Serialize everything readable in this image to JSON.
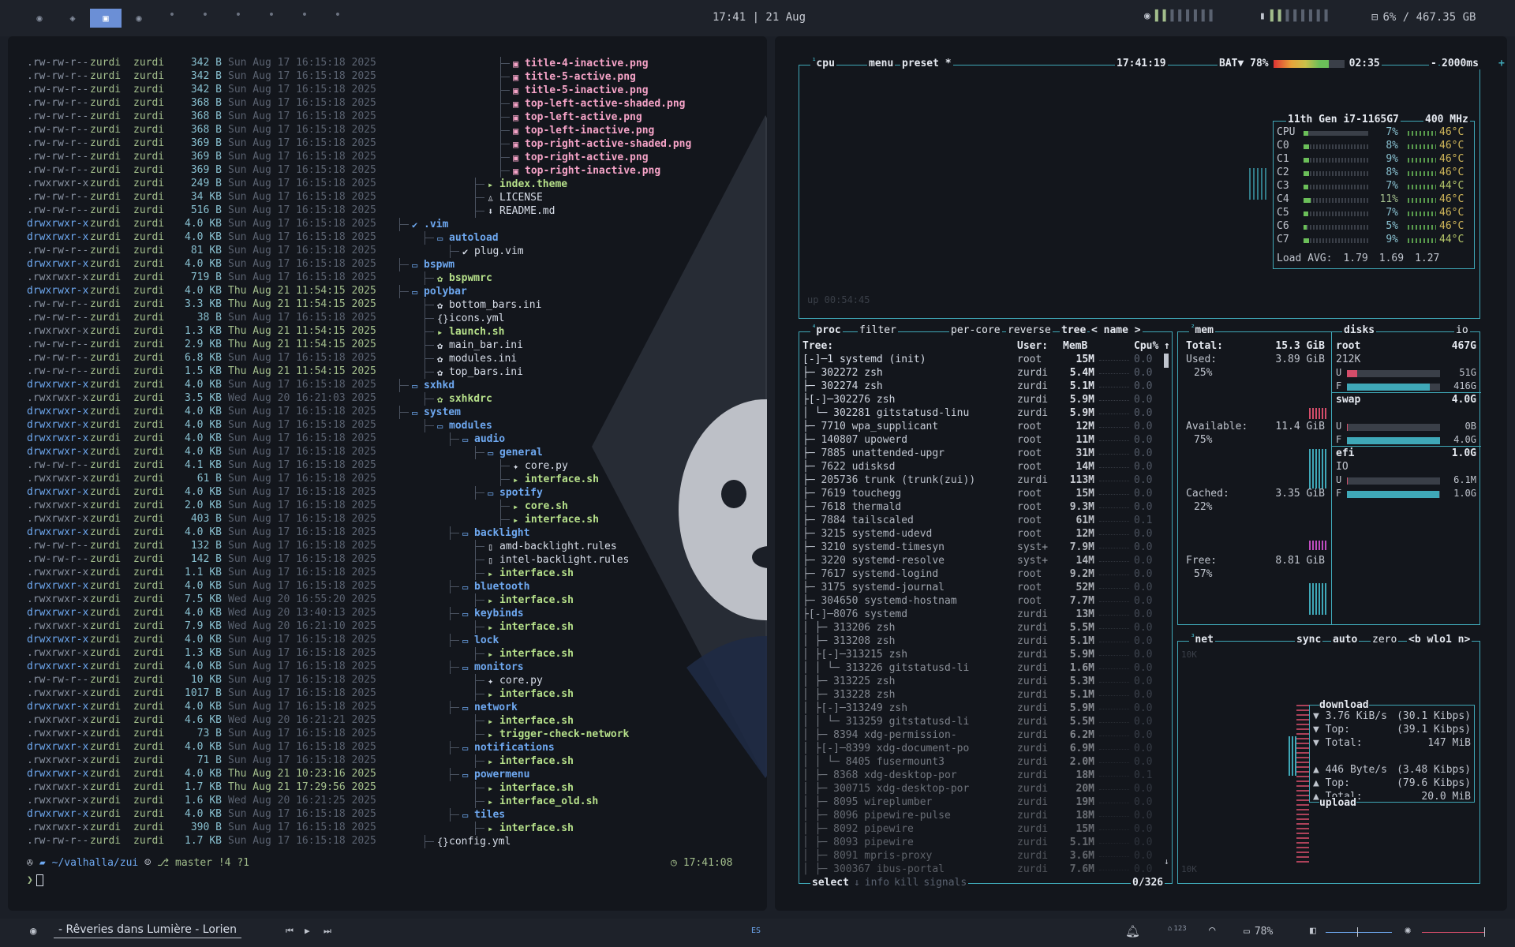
{
  "topbar": {
    "workspaces": [
      "◉",
      "◈",
      "▣",
      "◉"
    ],
    "clock": "17:41 | 21 Aug",
    "disk": "6% / 467.35 GB"
  },
  "bottombar": {
    "song": "- Rêveries dans Lumière - Lorien",
    "layout": "ES",
    "badge": "123",
    "battery": "78%"
  },
  "ls": [
    {
      "p": ".rw-rw-r--",
      "s": "342 B",
      "d": "Sun Aug 17 16:15:18 2025",
      "n": 0
    },
    {
      "p": ".rw-rw-r--",
      "s": "342 B",
      "d": "Sun Aug 17 16:15:18 2025",
      "n": 0
    },
    {
      "p": ".rw-rw-r--",
      "s": "342 B",
      "d": "Sun Aug 17 16:15:18 2025",
      "n": 0
    },
    {
      "p": ".rw-rw-r--",
      "s": "368 B",
      "d": "Sun Aug 17 16:15:18 2025",
      "n": 0
    },
    {
      "p": ".rw-rw-r--",
      "s": "368 B",
      "d": "Sun Aug 17 16:15:18 2025",
      "n": 0
    },
    {
      "p": ".rw-rw-r--",
      "s": "368 B",
      "d": "Sun Aug 17 16:15:18 2025",
      "n": 0
    },
    {
      "p": ".rw-rw-r--",
      "s": "369 B",
      "d": "Sun Aug 17 16:15:18 2025",
      "n": 0
    },
    {
      "p": ".rw-rw-r--",
      "s": "369 B",
      "d": "Sun Aug 17 16:15:18 2025",
      "n": 0
    },
    {
      "p": ".rw-rw-r--",
      "s": "369 B",
      "d": "Sun Aug 17 16:15:18 2025",
      "n": 0
    },
    {
      "p": ".rwxrwxr-x",
      "s": "249 B",
      "d": "Sun Aug 17 16:15:18 2025",
      "n": 0
    },
    {
      "p": ".rw-rw-r--",
      "s": "34 KB",
      "d": "Sun Aug 17 16:15:18 2025",
      "n": 0
    },
    {
      "p": ".rw-rw-r--",
      "s": "516 B",
      "d": "Sun Aug 17 16:15:18 2025",
      "n": 0
    },
    {
      "p": "drwxrwxr-x",
      "s": "4.0 KB",
      "d": "Sun Aug 17 16:15:18 2025",
      "n": 0
    },
    {
      "p": "drwxrwxr-x",
      "s": "4.0 KB",
      "d": "Sun Aug 17 16:15:18 2025",
      "n": 0
    },
    {
      "p": ".rw-rw-r--",
      "s": "81 KB",
      "d": "Sun Aug 17 16:15:18 2025",
      "n": 0
    },
    {
      "p": "drwxrwxr-x",
      "s": "4.0 KB",
      "d": "Sun Aug 17 16:15:18 2025",
      "n": 0
    },
    {
      "p": ".rwxrwxr-x",
      "s": "719 B",
      "d": "Sun Aug 17 16:15:18 2025",
      "n": 0
    },
    {
      "p": "drwxrwxr-x",
      "s": "4.0 KB",
      "d": "Thu Aug 21 11:54:15 2025",
      "n": 1
    },
    {
      "p": ".rw-rw-r--",
      "s": "3.3 KB",
      "d": "Thu Aug 21 11:54:15 2025",
      "n": 1
    },
    {
      "p": ".rw-rw-r--",
      "s": "38 B",
      "d": "Sun Aug 17 16:15:18 2025",
      "n": 0
    },
    {
      "p": ".rwxrwxr-x",
      "s": "1.3 KB",
      "d": "Thu Aug 21 11:54:15 2025",
      "n": 1
    },
    {
      "p": ".rw-rw-r--",
      "s": "2.9 KB",
      "d": "Thu Aug 21 11:54:15 2025",
      "n": 1
    },
    {
      "p": ".rw-rw-r--",
      "s": "6.8 KB",
      "d": "Sun Aug 17 16:15:18 2025",
      "n": 0
    },
    {
      "p": ".rw-rw-r--",
      "s": "1.5 KB",
      "d": "Thu Aug 21 11:54:15 2025",
      "n": 1
    },
    {
      "p": "drwxrwxr-x",
      "s": "4.0 KB",
      "d": "Sun Aug 17 16:15:18 2025",
      "n": 0
    },
    {
      "p": ".rwxrwxr-x",
      "s": "3.5 KB",
      "d": "Wed Aug 20 16:21:03 2025",
      "n": 0
    },
    {
      "p": "drwxrwxr-x",
      "s": "4.0 KB",
      "d": "Sun Aug 17 16:15:18 2025",
      "n": 0
    },
    {
      "p": "drwxrwxr-x",
      "s": "4.0 KB",
      "d": "Sun Aug 17 16:15:18 2025",
      "n": 0
    },
    {
      "p": "drwxrwxr-x",
      "s": "4.0 KB",
      "d": "Sun Aug 17 16:15:18 2025",
      "n": 0
    },
    {
      "p": "drwxrwxr-x",
      "s": "4.0 KB",
      "d": "Sun Aug 17 16:15:18 2025",
      "n": 0
    },
    {
      "p": ".rw-rw-r--",
      "s": "4.1 KB",
      "d": "Sun Aug 17 16:15:18 2025",
      "n": 0
    },
    {
      "p": ".rwxrwxr-x",
      "s": "61 B",
      "d": "Sun Aug 17 16:15:18 2025",
      "n": 0
    },
    {
      "p": "drwxrwxr-x",
      "s": "4.0 KB",
      "d": "Sun Aug 17 16:15:18 2025",
      "n": 0
    },
    {
      "p": ".rwxrwxr-x",
      "s": "2.0 KB",
      "d": "Sun Aug 17 16:15:18 2025",
      "n": 0
    },
    {
      "p": ".rwxrwxr-x",
      "s": "403 B",
      "d": "Sun Aug 17 16:15:18 2025",
      "n": 0
    },
    {
      "p": "drwxrwxr-x",
      "s": "4.0 KB",
      "d": "Sun Aug 17 16:15:18 2025",
      "n": 0
    },
    {
      "p": ".rw-rw-r--",
      "s": "132 B",
      "d": "Sun Aug 17 16:15:18 2025",
      "n": 0
    },
    {
      "p": ".rw-rw-r--",
      "s": "142 B",
      "d": "Sun Aug 17 16:15:18 2025",
      "n": 0
    },
    {
      "p": ".rwxrwxr-x",
      "s": "1.1 KB",
      "d": "Sun Aug 17 16:15:18 2025",
      "n": 0
    },
    {
      "p": "drwxrwxr-x",
      "s": "4.0 KB",
      "d": "Sun Aug 17 16:15:18 2025",
      "n": 0
    },
    {
      "p": ".rwxrwxr-x",
      "s": "7.5 KB",
      "d": "Wed Aug 20 16:55:20 2025",
      "n": 0
    },
    {
      "p": "drwxrwxr-x",
      "s": "4.0 KB",
      "d": "Wed Aug 20 13:40:13 2025",
      "n": 0
    },
    {
      "p": ".rwxrwxr-x",
      "s": "7.9 KB",
      "d": "Wed Aug 20 16:21:10 2025",
      "n": 0
    },
    {
      "p": "drwxrwxr-x",
      "s": "4.0 KB",
      "d": "Sun Aug 17 16:15:18 2025",
      "n": 0
    },
    {
      "p": ".rwxrwxr-x",
      "s": "1.3 KB",
      "d": "Sun Aug 17 16:15:18 2025",
      "n": 0
    },
    {
      "p": "drwxrwxr-x",
      "s": "4.0 KB",
      "d": "Sun Aug 17 16:15:18 2025",
      "n": 0
    },
    {
      "p": ".rw-rw-r--",
      "s": "10 KB",
      "d": "Sun Aug 17 16:15:18 2025",
      "n": 0
    },
    {
      "p": ".rwxrwxr-x",
      "s": "1017 B",
      "d": "Sun Aug 17 16:15:18 2025",
      "n": 0
    },
    {
      "p": "drwxrwxr-x",
      "s": "4.0 KB",
      "d": "Sun Aug 17 16:15:18 2025",
      "n": 0
    },
    {
      "p": ".rwxrwxr-x",
      "s": "4.6 KB",
      "d": "Wed Aug 20 16:21:21 2025",
      "n": 0
    },
    {
      "p": ".rwxrwxr-x",
      "s": "73 B",
      "d": "Sun Aug 17 16:15:18 2025",
      "n": 0
    },
    {
      "p": "drwxrwxr-x",
      "s": "4.0 KB",
      "d": "Sun Aug 17 16:15:18 2025",
      "n": 0
    },
    {
      "p": ".rwxrwxr-x",
      "s": "71 B",
      "d": "Sun Aug 17 16:15:18 2025",
      "n": 0
    },
    {
      "p": "drwxrwxr-x",
      "s": "4.0 KB",
      "d": "Thu Aug 21 10:23:16 2025",
      "n": 1
    },
    {
      "p": ".rwxrwxr-x",
      "s": "1.7 KB",
      "d": "Thu Aug 21 17:29:56 2025",
      "n": 1
    },
    {
      "p": ".rwxrwxr-x",
      "s": "1.6 KB",
      "d": "Wed Aug 20 16:21:25 2025",
      "n": 0
    },
    {
      "p": "drwxrwxr-x",
      "s": "4.0 KB",
      "d": "Sun Aug 17 16:15:18 2025",
      "n": 0
    },
    {
      "p": ".rwxrwxr-x",
      "s": "390 B",
      "d": "Sun Aug 17 16:15:18 2025",
      "n": 0
    },
    {
      "p": ".rw-rw-r--",
      "s": "1.7 KB",
      "d": "Sun Aug 17 16:15:18 2025",
      "n": 0
    }
  ],
  "ls_owner": "zurdi",
  "tree": [
    {
      "t": "title-4-inactive.png",
      "c": "f-img",
      "i": "▣",
      "x": 4
    },
    {
      "t": "title-5-active.png",
      "c": "f-img",
      "i": "▣",
      "x": 4
    },
    {
      "t": "title-5-inactive.png",
      "c": "f-img",
      "i": "▣",
      "x": 4
    },
    {
      "t": "top-left-active-shaded.png",
      "c": "f-img",
      "i": "▣",
      "x": 4
    },
    {
      "t": "top-left-active.png",
      "c": "f-img",
      "i": "▣",
      "x": 4
    },
    {
      "t": "top-left-inactive.png",
      "c": "f-img",
      "i": "▣",
      "x": 4
    },
    {
      "t": "top-right-active-shaded.png",
      "c": "f-img",
      "i": "▣",
      "x": 4
    },
    {
      "t": "top-right-active.png",
      "c": "f-img",
      "i": "▣",
      "x": 4
    },
    {
      "t": "top-right-inactive.png",
      "c": "f-img",
      "i": "▣",
      "x": 4
    },
    {
      "t": "index.theme",
      "c": "f-theme",
      "i": "▸",
      "x": 3
    },
    {
      "t": "LICENSE",
      "c": "f-plain",
      "i": "♙",
      "x": 3
    },
    {
      "t": "README.md",
      "c": "f-plain",
      "i": "⬇",
      "x": 3
    },
    {
      "t": ".vim",
      "c": "f-dir",
      "i": "✔",
      "x": 0
    },
    {
      "t": "autoload",
      "c": "f-dir",
      "i": "▭",
      "x": 1
    },
    {
      "t": "plug.vim",
      "c": "f-plain",
      "i": "✔",
      "x": 2
    },
    {
      "t": "bspwm",
      "c": "f-dir",
      "i": "▭",
      "x": 0
    },
    {
      "t": "bspwmrc",
      "c": "f-sh",
      "i": "✿",
      "x": 1
    },
    {
      "t": "polybar",
      "c": "f-dir",
      "i": "▭",
      "x": 0
    },
    {
      "t": "bottom_bars.ini",
      "c": "f-plain",
      "i": "✿",
      "x": 1
    },
    {
      "t": "icons.yml",
      "c": "f-plain",
      "i": "{}",
      "x": 1
    },
    {
      "t": "launch.sh",
      "c": "f-sh",
      "i": "▸",
      "x": 1
    },
    {
      "t": "main_bar.ini",
      "c": "f-plain",
      "i": "✿",
      "x": 1
    },
    {
      "t": "modules.ini",
      "c": "f-plain",
      "i": "✿",
      "x": 1
    },
    {
      "t": "top_bars.ini",
      "c": "f-plain",
      "i": "✿",
      "x": 1
    },
    {
      "t": "sxhkd",
      "c": "f-dir",
      "i": "▭",
      "x": 0
    },
    {
      "t": "sxhkdrc",
      "c": "f-sh",
      "i": "✿",
      "x": 1
    },
    {
      "t": "system",
      "c": "f-dir",
      "i": "▭",
      "x": 0
    },
    {
      "t": "modules",
      "c": "f-dir",
      "i": "▭",
      "x": 1
    },
    {
      "t": "audio",
      "c": "f-dir",
      "i": "▭",
      "x": 2
    },
    {
      "t": "general",
      "c": "f-dir",
      "i": "▭",
      "x": 3
    },
    {
      "t": "core.py",
      "c": "f-plain",
      "i": "✦",
      "x": 4
    },
    {
      "t": "interface.sh",
      "c": "f-sh",
      "i": "▸",
      "x": 4
    },
    {
      "t": "spotify",
      "c": "f-dir",
      "i": "▭",
      "x": 3
    },
    {
      "t": "core.sh",
      "c": "f-sh",
      "i": "▸",
      "x": 4
    },
    {
      "t": "interface.sh",
      "c": "f-sh",
      "i": "▸",
      "x": 4
    },
    {
      "t": "backlight",
      "c": "f-dir",
      "i": "▭",
      "x": 2
    },
    {
      "t": "amd-backlight.rules",
      "c": "f-plain",
      "i": "▯",
      "x": 3
    },
    {
      "t": "intel-backlight.rules",
      "c": "f-plain",
      "i": "▯",
      "x": 3
    },
    {
      "t": "interface.sh",
      "c": "f-sh",
      "i": "▸",
      "x": 3
    },
    {
      "t": "bluetooth",
      "c": "f-dir",
      "i": "▭",
      "x": 2
    },
    {
      "t": "interface.sh",
      "c": "f-sh",
      "i": "▸",
      "x": 3
    },
    {
      "t": "keybinds",
      "c": "f-dir",
      "i": "▭",
      "x": 2
    },
    {
      "t": "interface.sh",
      "c": "f-sh",
      "i": "▸",
      "x": 3
    },
    {
      "t": "lock",
      "c": "f-dir",
      "i": "▭",
      "x": 2
    },
    {
      "t": "interface.sh",
      "c": "f-sh",
      "i": "▸",
      "x": 3
    },
    {
      "t": "monitors",
      "c": "f-dir",
      "i": "▭",
      "x": 2
    },
    {
      "t": "core.py",
      "c": "f-plain",
      "i": "✦",
      "x": 3
    },
    {
      "t": "interface.sh",
      "c": "f-sh",
      "i": "▸",
      "x": 3
    },
    {
      "t": "network",
      "c": "f-dir",
      "i": "▭",
      "x": 2
    },
    {
      "t": "interface.sh",
      "c": "f-sh",
      "i": "▸",
      "x": 3
    },
    {
      "t": "trigger-check-network",
      "c": "f-sh",
      "i": "▸",
      "x": 3
    },
    {
      "t": "notifications",
      "c": "f-dir",
      "i": "▭",
      "x": 2
    },
    {
      "t": "interface.sh",
      "c": "f-sh",
      "i": "▸",
      "x": 3
    },
    {
      "t": "powermenu",
      "c": "f-dir",
      "i": "▭",
      "x": 2
    },
    {
      "t": "interface.sh",
      "c": "f-sh",
      "i": "▸",
      "x": 3
    },
    {
      "t": "interface_old.sh",
      "c": "f-sh",
      "i": "▸",
      "x": 3
    },
    {
      "t": "tiles",
      "c": "f-dir",
      "i": "▭",
      "x": 2
    },
    {
      "t": "interface.sh",
      "c": "f-sh",
      "i": "▸",
      "x": 3
    },
    {
      "t": "config.yml",
      "c": "f-plain",
      "i": "{}",
      "x": 1
    }
  ],
  "prompt": {
    "path": "~/valhalla/zui",
    "branch": "master !4 ?1",
    "time": "17:41:08"
  },
  "cpu": {
    "tab": "cpu",
    "menu": "menu",
    "preset": "preset *",
    "time": "17:41:19",
    "bat": "BAT▼ 78%",
    "battime": "02:35",
    "rate": "2000ms",
    "model": "11th Gen i7-1165G7",
    "freq": "400 MHz",
    "uptime": "up 00:54:45",
    "cores": [
      {
        "n": "CPU",
        "p": "7%",
        "t": "46°C",
        "v": 0.07
      },
      {
        "n": "C0",
        "p": "8%",
        "t": "46°C",
        "v": 0.08
      },
      {
        "n": "C1",
        "p": "9%",
        "t": "46°C",
        "v": 0.09
      },
      {
        "n": "C2",
        "p": "8%",
        "t": "46°C",
        "v": 0.08
      },
      {
        "n": "C3",
        "p": "7%",
        "t": "44°C",
        "v": 0.07
      },
      {
        "n": "C4",
        "p": "11%",
        "t": "46°C",
        "v": 0.11
      },
      {
        "n": "C5",
        "p": "7%",
        "t": "46°C",
        "v": 0.07
      },
      {
        "n": "C6",
        "p": "5%",
        "t": "46°C",
        "v": 0.05
      },
      {
        "n": "C7",
        "p": "9%",
        "t": "44°C",
        "v": 0.09
      }
    ],
    "load": [
      "Load AVG:",
      "1.79",
      "1.69",
      "1.27"
    ]
  },
  "proc": {
    "tabs": [
      "proc",
      "filter",
      "per-core",
      "reverse",
      "tree",
      "< name >"
    ],
    "headers": [
      "Tree:",
      "User:",
      "MemB",
      "Cpu%"
    ],
    "footer": {
      "select": "select",
      "info": "info",
      "kill": "kill",
      "signals": "signals",
      "count": "0/326"
    },
    "rows": [
      [
        "[-]─1 systemd (init)",
        "root",
        "15M",
        "0.0"
      ],
      [
        "├─ 302272 zsh",
        "zurdi",
        "5.4M",
        "0.0"
      ],
      [
        "├─ 302274 zsh",
        "zurdi",
        "5.1M",
        "0.0"
      ],
      [
        "├[-]─302276 zsh",
        "zurdi",
        "5.9M",
        "0.0"
      ],
      [
        "│  └─ 302281 gitstatusd-linu",
        "zurdi",
        "5.9M",
        "0.0"
      ],
      [
        "├─ 7710 wpa_supplicant",
        "root",
        "12M",
        "0.0"
      ],
      [
        "├─ 140807 upowerd",
        "root",
        "11M",
        "0.0"
      ],
      [
        "├─ 7885 unattended-upgr",
        "root",
        "31M",
        "0.0"
      ],
      [
        "├─ 7622 udisksd",
        "root",
        "14M",
        "0.0"
      ],
      [
        "├─ 205736 trunk (trunk(zui))",
        "zurdi",
        "113M",
        "0.0"
      ],
      [
        "├─ 7619 touchegg",
        "root",
        "15M",
        "0.0"
      ],
      [
        "├─ 7618 thermald",
        "root",
        "9.3M",
        "0.0"
      ],
      [
        "├─ 7884 tailscaled",
        "root",
        "61M",
        "0.1"
      ],
      [
        "├─ 3215 systemd-udevd",
        "root",
        "12M",
        "0.0"
      ],
      [
        "├─ 3210 systemd-timesyn",
        "syst+",
        "7.9M",
        "0.0"
      ],
      [
        "├─ 3220 systemd-resolve",
        "syst+",
        "14M",
        "0.0"
      ],
      [
        "├─ 7617 systemd-logind",
        "root",
        "9.2M",
        "0.0"
      ],
      [
        "├─ 3175 systemd-journal",
        "root",
        "52M",
        "0.0"
      ],
      [
        "├─ 304650 systemd-hostnam",
        "root",
        "7.7M",
        "0.0"
      ],
      [
        "├[-]─8076 systemd",
        "zurdi",
        "13M",
        "0.0"
      ],
      [
        "│  ├─ 313206 zsh",
        "zurdi",
        "5.5M",
        "0.0"
      ],
      [
        "│  ├─ 313208 zsh",
        "zurdi",
        "5.1M",
        "0.0"
      ],
      [
        "│  ├[-]─313215 zsh",
        "zurdi",
        "5.9M",
        "0.0"
      ],
      [
        "│  │  └─ 313226 gitstatusd-li",
        "zurdi",
        "1.6M",
        "0.0"
      ],
      [
        "│  ├─ 313225 zsh",
        "zurdi",
        "5.3M",
        "0.0"
      ],
      [
        "│  ├─ 313228 zsh",
        "zurdi",
        "5.1M",
        "0.0"
      ],
      [
        "│  ├[-]─313249 zsh",
        "zurdi",
        "5.9M",
        "0.0"
      ],
      [
        "│  │  └─ 313259 gitstatusd-li",
        "zurdi",
        "5.5M",
        "0.0"
      ],
      [
        "│  ├─ 8394 xdg-permission-",
        "zurdi",
        "6.2M",
        "0.0"
      ],
      [
        "│  ├[-]─8399 xdg-document-po",
        "zurdi",
        "6.9M",
        "0.0"
      ],
      [
        "│  │  └─ 8405 fusermount3",
        "zurdi",
        "2.0M",
        "0.0"
      ],
      [
        "│  ├─ 8368 xdg-desktop-por",
        "zurdi",
        "18M",
        "0.1"
      ],
      [
        "│  ├─ 300715 xdg-desktop-por",
        "zurdi",
        "20M",
        "0.0"
      ],
      [
        "│  ├─ 8095 wireplumber",
        "zurdi",
        "19M",
        "0.0"
      ],
      [
        "│  ├─ 8096 pipewire-pulse",
        "zurdi",
        "18M",
        "0.0"
      ],
      [
        "│  ├─ 8092 pipewire",
        "zurdi",
        "15M",
        "0.0"
      ],
      [
        "│  ├─ 8093 pipewire",
        "zurdi",
        "5.1M",
        "0.0"
      ],
      [
        "│  ├─ 8091 mpris-proxy",
        "zurdi",
        "3.6M",
        "0.0"
      ],
      [
        "│  ├─ 300367 ibus-portal",
        "zurdi",
        "7.6M",
        "0.0"
      ]
    ]
  },
  "mem": {
    "title": "mem",
    "total_l": "Total:",
    "total": "15.3 GiB",
    "used_l": "Used:",
    "used": "3.89 GiB",
    "used_p": "25%",
    "avail_l": "Available:",
    "avail": "11.4 GiB",
    "avail_p": "75%",
    "cached_l": "Cached:",
    "cached": "3.35 GiB",
    "cached_p": "22%",
    "free_l": "Free:",
    "free": "8.81 GiB",
    "free_p": "57%"
  },
  "disks": {
    "title": "disks",
    "io": "io",
    "items": [
      {
        "name": "root",
        "size": "467G",
        "sub": "212K",
        "u": "51G",
        "f": "416G",
        "uv": 0.11,
        "fv": 0.89
      },
      {
        "name": "swap",
        "size": "4.0G",
        "sub": "",
        "u": "0B",
        "f": "4.0G",
        "uv": 0,
        "fv": 1
      },
      {
        "name": "efi",
        "size": "1.0G",
        "sub": "IO",
        "u": "6.1M",
        "f": "1.0G",
        "uv": 0.01,
        "fv": 0.99
      }
    ]
  },
  "net": {
    "title": "net",
    "sync": "sync",
    "auto": "auto",
    "zero": "zero",
    "iface": "<b wlo1 n>",
    "scale_top": "10K",
    "scale_bot": "10K",
    "download": "download",
    "upload": "upload",
    "dl": [
      [
        "▼ 3.76 KiB/s",
        "(30.1 Kibps)"
      ],
      [
        "▼ Top:",
        "(39.1 Kibps)"
      ],
      [
        "▼ Total:",
        "147 MiB"
      ]
    ],
    "ul": [
      [
        "▲ 446 Byte/s",
        "(3.48 Kibps)"
      ],
      [
        "▲ Top:",
        "(79.6 Kibps)"
      ],
      [
        "▲ Total:",
        "20.0 MiB"
      ]
    ]
  }
}
